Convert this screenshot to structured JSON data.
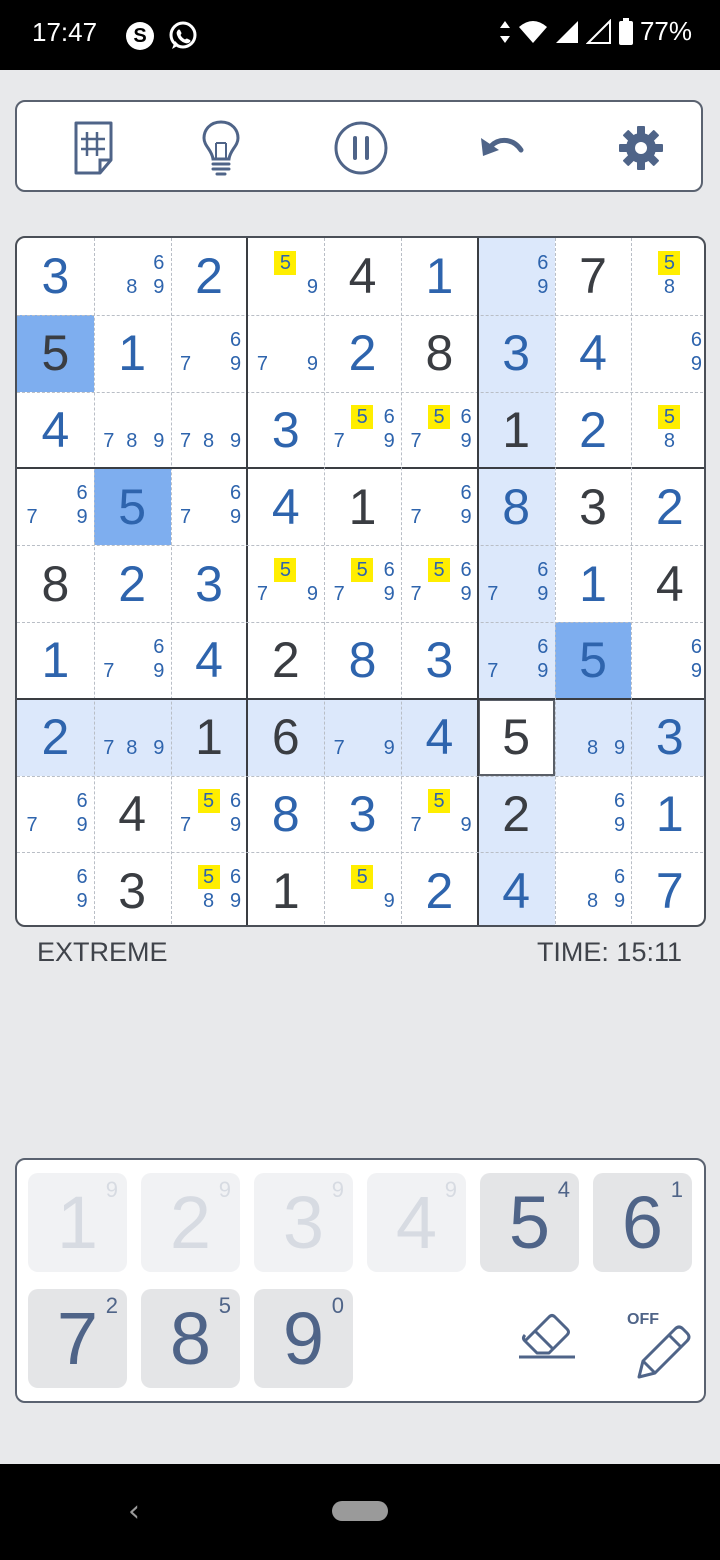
{
  "status_bar": {
    "time": "17:47",
    "skype_letter": "S",
    "battery": "77%"
  },
  "toolbar": {
    "icons": [
      "notes-sheet-icon",
      "hint-lightbulb-icon",
      "pause-icon",
      "undo-icon",
      "settings-gear-icon"
    ]
  },
  "colors": {
    "accent": "#2e64ad",
    "given": "#3a3d42",
    "row_col_highlight": "#dce8fb",
    "selected_number_bg": "#7eaeef",
    "candidate_highlight": "#ffee00",
    "keypad_digit": "#4f6488"
  },
  "grid": {
    "selected_cell": {
      "row": 7,
      "col": 7
    },
    "rows": [
      [
        {
          "v": "3",
          "t": "u"
        },
        {
          "c": [
            "6",
            "8",
            "9"
          ]
        },
        {
          "v": "2",
          "t": "u"
        },
        {
          "c": [
            "5",
            "9"
          ],
          "h": [
            "5"
          ]
        },
        {
          "v": "4",
          "t": "g"
        },
        {
          "v": "1",
          "t": "u"
        },
        {
          "c": [
            "6",
            "9"
          ]
        },
        {
          "v": "7",
          "t": "g"
        },
        {
          "c": [
            "5",
            "8"
          ],
          "h": [
            "5"
          ]
        }
      ],
      [
        {
          "v": "5",
          "t": "g"
        },
        {
          "v": "1",
          "t": "u"
        },
        {
          "c": [
            "6",
            "7",
            "9"
          ]
        },
        {
          "c": [
            "7",
            "9"
          ]
        },
        {
          "v": "2",
          "t": "u"
        },
        {
          "v": "8",
          "t": "g"
        },
        {
          "v": "3",
          "t": "u"
        },
        {
          "v": "4",
          "t": "u"
        },
        {
          "c": [
            "6",
            "9"
          ]
        }
      ],
      [
        {
          "v": "4",
          "t": "u"
        },
        {
          "c": [
            "7",
            "8",
            "9"
          ]
        },
        {
          "c": [
            "7",
            "8",
            "9"
          ]
        },
        {
          "v": "3",
          "t": "u"
        },
        {
          "c": [
            "5",
            "6",
            "7",
            "9"
          ],
          "h": [
            "5"
          ]
        },
        {
          "c": [
            "5",
            "6",
            "7",
            "9"
          ],
          "h": [
            "5"
          ]
        },
        {
          "v": "1",
          "t": "g"
        },
        {
          "v": "2",
          "t": "u"
        },
        {
          "c": [
            "5",
            "8"
          ],
          "h": [
            "5"
          ]
        }
      ],
      [
        {
          "c": [
            "6",
            "7",
            "9"
          ]
        },
        {
          "v": "5",
          "t": "u"
        },
        {
          "c": [
            "6",
            "7",
            "9"
          ]
        },
        {
          "v": "4",
          "t": "u"
        },
        {
          "v": "1",
          "t": "g"
        },
        {
          "c": [
            "6",
            "7",
            "9"
          ]
        },
        {
          "v": "8",
          "t": "u"
        },
        {
          "v": "3",
          "t": "g"
        },
        {
          "v": "2",
          "t": "u"
        }
      ],
      [
        {
          "v": "8",
          "t": "g"
        },
        {
          "v": "2",
          "t": "u"
        },
        {
          "v": "3",
          "t": "u"
        },
        {
          "c": [
            "5",
            "7",
            "9"
          ],
          "h": [
            "5"
          ]
        },
        {
          "c": [
            "5",
            "6",
            "7",
            "9"
          ],
          "h": [
            "5"
          ]
        },
        {
          "c": [
            "5",
            "6",
            "7",
            "9"
          ],
          "h": [
            "5"
          ]
        },
        {
          "c": [
            "6",
            "7",
            "9"
          ]
        },
        {
          "v": "1",
          "t": "u"
        },
        {
          "v": "4",
          "t": "g"
        }
      ],
      [
        {
          "v": "1",
          "t": "u"
        },
        {
          "c": [
            "6",
            "7",
            "9"
          ]
        },
        {
          "v": "4",
          "t": "u"
        },
        {
          "v": "2",
          "t": "g"
        },
        {
          "v": "8",
          "t": "u"
        },
        {
          "v": "3",
          "t": "u"
        },
        {
          "c": [
            "6",
            "7",
            "9"
          ]
        },
        {
          "v": "5",
          "t": "u"
        },
        {
          "c": [
            "6",
            "9"
          ]
        }
      ],
      [
        {
          "v": "2",
          "t": "u"
        },
        {
          "c": [
            "7",
            "8",
            "9"
          ]
        },
        {
          "v": "1",
          "t": "g"
        },
        {
          "v": "6",
          "t": "g"
        },
        {
          "c": [
            "7",
            "9"
          ]
        },
        {
          "v": "4",
          "t": "u"
        },
        {
          "v": "5",
          "t": "g"
        },
        {
          "c": [
            "8",
            "9"
          ]
        },
        {
          "v": "3",
          "t": "u"
        }
      ],
      [
        {
          "c": [
            "6",
            "7",
            "9"
          ]
        },
        {
          "v": "4",
          "t": "g"
        },
        {
          "c": [
            "5",
            "6",
            "7",
            "9"
          ],
          "h": [
            "5"
          ]
        },
        {
          "v": "8",
          "t": "u"
        },
        {
          "v": "3",
          "t": "u"
        },
        {
          "c": [
            "5",
            "7",
            "9"
          ],
          "h": [
            "5"
          ]
        },
        {
          "v": "2",
          "t": "g"
        },
        {
          "c": [
            "6",
            "9"
          ]
        },
        {
          "v": "1",
          "t": "u"
        }
      ],
      [
        {
          "c": [
            "6",
            "9"
          ]
        },
        {
          "v": "3",
          "t": "g"
        },
        {
          "c": [
            "5",
            "6",
            "8",
            "9"
          ],
          "h": [
            "5"
          ]
        },
        {
          "v": "1",
          "t": "g"
        },
        {
          "c": [
            "5",
            "9"
          ],
          "h": [
            "5"
          ]
        },
        {
          "v": "2",
          "t": "u"
        },
        {
          "v": "4",
          "t": "u"
        },
        {
          "c": [
            "6",
            "8",
            "9"
          ]
        },
        {
          "v": "7",
          "t": "u"
        }
      ]
    ]
  },
  "game_info": {
    "difficulty": "EXTREME",
    "timer": "TIME: 15:11"
  },
  "keypad": {
    "keys": [
      {
        "digit": "1",
        "count": "9",
        "state": "disabled"
      },
      {
        "digit": "2",
        "count": "9",
        "state": "disabled"
      },
      {
        "digit": "3",
        "count": "9",
        "state": "disabled"
      },
      {
        "digit": "4",
        "count": "9",
        "state": "disabled"
      },
      {
        "digit": "5",
        "count": "4",
        "state": "active"
      },
      {
        "digit": "6",
        "count": "1",
        "state": "active"
      },
      {
        "digit": "7",
        "count": "2",
        "state": "active"
      },
      {
        "digit": "8",
        "count": "5",
        "state": "active"
      },
      {
        "digit": "9",
        "count": "0",
        "state": "active"
      }
    ],
    "pencil_mode": "OFF"
  }
}
